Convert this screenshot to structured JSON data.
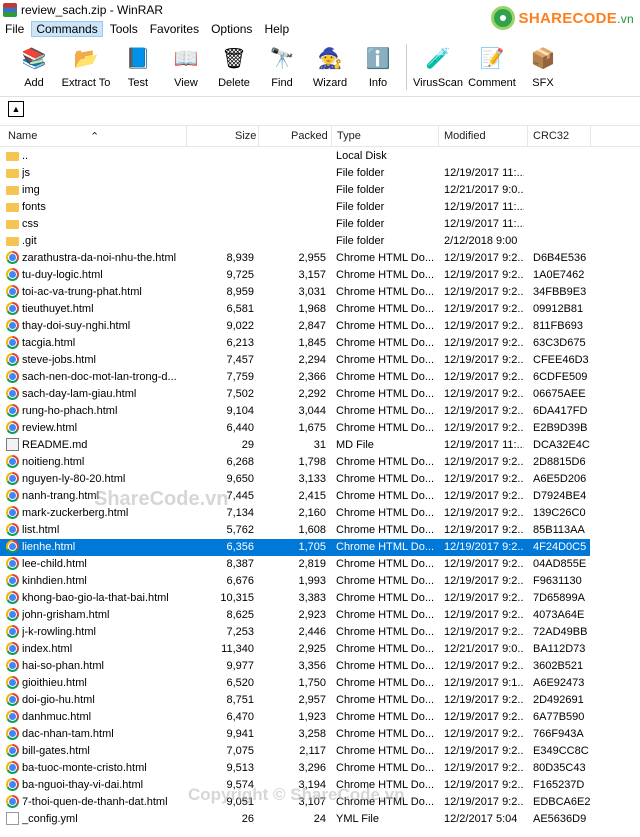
{
  "window": {
    "title": "review_sach.zip - WinRAR"
  },
  "logo": {
    "brand": "SHARECODE",
    "suffix": ".vn"
  },
  "menu": [
    "File",
    "Commands",
    "Tools",
    "Favorites",
    "Options",
    "Help"
  ],
  "toolbar": [
    {
      "label": "Add",
      "icon": "add-icon"
    },
    {
      "label": "Extract To",
      "icon": "extract-icon"
    },
    {
      "label": "Test",
      "icon": "test-icon"
    },
    {
      "label": "View",
      "icon": "view-icon"
    },
    {
      "label": "Delete",
      "icon": "delete-icon"
    },
    {
      "label": "Find",
      "icon": "find-icon"
    },
    {
      "label": "Wizard",
      "icon": "wizard-icon"
    },
    {
      "label": "Info",
      "icon": "info-icon"
    },
    {
      "label": "VirusScan",
      "icon": "virusscan-icon"
    },
    {
      "label": "Comment",
      "icon": "comment-icon"
    },
    {
      "label": "SFX",
      "icon": "sfx-icon"
    }
  ],
  "columns": [
    "Name",
    "Size",
    "Packed",
    "Type",
    "Modified",
    "CRC32"
  ],
  "files": [
    {
      "name": "..",
      "size": "",
      "packed": "",
      "type": "Local Disk",
      "modified": "",
      "crc": "",
      "kind": "folder"
    },
    {
      "name": "js",
      "size": "",
      "packed": "",
      "type": "File folder",
      "modified": "12/19/2017 11:...",
      "crc": "",
      "kind": "folder"
    },
    {
      "name": "img",
      "size": "",
      "packed": "",
      "type": "File folder",
      "modified": "12/21/2017 9:0...",
      "crc": "",
      "kind": "folder"
    },
    {
      "name": "fonts",
      "size": "",
      "packed": "",
      "type": "File folder",
      "modified": "12/19/2017 11:...",
      "crc": "",
      "kind": "folder"
    },
    {
      "name": "css",
      "size": "",
      "packed": "",
      "type": "File folder",
      "modified": "12/19/2017 11:...",
      "crc": "",
      "kind": "folder"
    },
    {
      "name": ".git",
      "size": "",
      "packed": "",
      "type": "File folder",
      "modified": "2/12/2018 9:00",
      "crc": "",
      "kind": "folder"
    },
    {
      "name": "zarathustra-da-noi-nhu-the.html",
      "size": "8,939",
      "packed": "2,955",
      "type": "Chrome HTML Do...",
      "modified": "12/19/2017 9:2...",
      "crc": "D6B4E536",
      "kind": "html"
    },
    {
      "name": "tu-duy-logic.html",
      "size": "9,725",
      "packed": "3,157",
      "type": "Chrome HTML Do...",
      "modified": "12/19/2017 9:2...",
      "crc": "1A0E7462",
      "kind": "html"
    },
    {
      "name": "toi-ac-va-trung-phat.html",
      "size": "8,959",
      "packed": "3,031",
      "type": "Chrome HTML Do...",
      "modified": "12/19/2017 9:2...",
      "crc": "34FBB9E3",
      "kind": "html"
    },
    {
      "name": "tieuthuyet.html",
      "size": "6,581",
      "packed": "1,968",
      "type": "Chrome HTML Do...",
      "modified": "12/19/2017 9:2...",
      "crc": "09912B81",
      "kind": "html"
    },
    {
      "name": "thay-doi-suy-nghi.html",
      "size": "9,022",
      "packed": "2,847",
      "type": "Chrome HTML Do...",
      "modified": "12/19/2017 9:2...",
      "crc": "811FB693",
      "kind": "html"
    },
    {
      "name": "tacgia.html",
      "size": "6,213",
      "packed": "1,845",
      "type": "Chrome HTML Do...",
      "modified": "12/19/2017 9:2...",
      "crc": "63C3D675",
      "kind": "html"
    },
    {
      "name": "steve-jobs.html",
      "size": "7,457",
      "packed": "2,294",
      "type": "Chrome HTML Do...",
      "modified": "12/19/2017 9:2...",
      "crc": "CFEE46D3",
      "kind": "html"
    },
    {
      "name": "sach-nen-doc-mot-lan-trong-d...",
      "size": "7,759",
      "packed": "2,366",
      "type": "Chrome HTML Do...",
      "modified": "12/19/2017 9:2...",
      "crc": "6CDFE509",
      "kind": "html"
    },
    {
      "name": "sach-day-lam-giau.html",
      "size": "7,502",
      "packed": "2,292",
      "type": "Chrome HTML Do...",
      "modified": "12/19/2017 9:2...",
      "crc": "06675AEE",
      "kind": "html"
    },
    {
      "name": "rung-ho-phach.html",
      "size": "9,104",
      "packed": "3,044",
      "type": "Chrome HTML Do...",
      "modified": "12/19/2017 9:2...",
      "crc": "6DA417FD",
      "kind": "html"
    },
    {
      "name": "review.html",
      "size": "6,440",
      "packed": "1,675",
      "type": "Chrome HTML Do...",
      "modified": "12/19/2017 9:2...",
      "crc": "E2B9D39B",
      "kind": "html"
    },
    {
      "name": "README.md",
      "size": "29",
      "packed": "31",
      "type": "MD File",
      "modified": "12/19/2017 11:...",
      "crc": "DCA32E4C",
      "kind": "md"
    },
    {
      "name": "noitieng.html",
      "size": "6,268",
      "packed": "1,798",
      "type": "Chrome HTML Do...",
      "modified": "12/19/2017 9:2...",
      "crc": "2D8815D6",
      "kind": "html"
    },
    {
      "name": "nguyen-ly-80-20.html",
      "size": "9,650",
      "packed": "3,133",
      "type": "Chrome HTML Do...",
      "modified": "12/19/2017 9:2...",
      "crc": "A6E5D206",
      "kind": "html"
    },
    {
      "name": "nanh-trang.html",
      "size": "7,445",
      "packed": "2,415",
      "type": "Chrome HTML Do...",
      "modified": "12/19/2017 9:2...",
      "crc": "D7924BE4",
      "kind": "html"
    },
    {
      "name": "mark-zuckerberg.html",
      "size": "7,134",
      "packed": "2,160",
      "type": "Chrome HTML Do...",
      "modified": "12/19/2017 9:2...",
      "crc": "139C26C0",
      "kind": "html"
    },
    {
      "name": "list.html",
      "size": "5,762",
      "packed": "1,608",
      "type": "Chrome HTML Do...",
      "modified": "12/19/2017 9:2...",
      "crc": "85B113AA",
      "kind": "html"
    },
    {
      "name": "lienhe.html",
      "size": "6,356",
      "packed": "1,705",
      "type": "Chrome HTML Do...",
      "modified": "12/19/2017 9:2...",
      "crc": "4F24D0C5",
      "kind": "html",
      "selected": true
    },
    {
      "name": "lee-child.html",
      "size": "8,387",
      "packed": "2,819",
      "type": "Chrome HTML Do...",
      "modified": "12/19/2017 9:2...",
      "crc": "04AD855E",
      "kind": "html"
    },
    {
      "name": "kinhdien.html",
      "size": "6,676",
      "packed": "1,993",
      "type": "Chrome HTML Do...",
      "modified": "12/19/2017 9:2...",
      "crc": "F9631130",
      "kind": "html"
    },
    {
      "name": "khong-bao-gio-la-that-bai.html",
      "size": "10,315",
      "packed": "3,383",
      "type": "Chrome HTML Do...",
      "modified": "12/19/2017 9:2...",
      "crc": "7D65899A",
      "kind": "html"
    },
    {
      "name": "john-grisham.html",
      "size": "8,625",
      "packed": "2,923",
      "type": "Chrome HTML Do...",
      "modified": "12/19/2017 9:2...",
      "crc": "4073A64E",
      "kind": "html"
    },
    {
      "name": "j-k-rowling.html",
      "size": "7,253",
      "packed": "2,446",
      "type": "Chrome HTML Do...",
      "modified": "12/19/2017 9:2...",
      "crc": "72AD49BB",
      "kind": "html"
    },
    {
      "name": "index.html",
      "size": "11,340",
      "packed": "2,925",
      "type": "Chrome HTML Do...",
      "modified": "12/21/2017 9:0...",
      "crc": "BA112D73",
      "kind": "html"
    },
    {
      "name": "hai-so-phan.html",
      "size": "9,977",
      "packed": "3,356",
      "type": "Chrome HTML Do...",
      "modified": "12/19/2017 9:2...",
      "crc": "3602B521",
      "kind": "html"
    },
    {
      "name": "gioithieu.html",
      "size": "6,520",
      "packed": "1,750",
      "type": "Chrome HTML Do...",
      "modified": "12/19/2017 9:1...",
      "crc": "A6E92473",
      "kind": "html"
    },
    {
      "name": "doi-gio-hu.html",
      "size": "8,751",
      "packed": "2,957",
      "type": "Chrome HTML Do...",
      "modified": "12/19/2017 9:2...",
      "crc": "2D492691",
      "kind": "html"
    },
    {
      "name": "danhmuc.html",
      "size": "6,470",
      "packed": "1,923",
      "type": "Chrome HTML Do...",
      "modified": "12/19/2017 9:2...",
      "crc": "6A77B590",
      "kind": "html"
    },
    {
      "name": "dac-nhan-tam.html",
      "size": "9,941",
      "packed": "3,258",
      "type": "Chrome HTML Do...",
      "modified": "12/19/2017 9:2...",
      "crc": "766F943A",
      "kind": "html"
    },
    {
      "name": "bill-gates.html",
      "size": "7,075",
      "packed": "2,117",
      "type": "Chrome HTML Do...",
      "modified": "12/19/2017 9:2...",
      "crc": "E349CC8C",
      "kind": "html"
    },
    {
      "name": "ba-tuoc-monte-cristo.html",
      "size": "9,513",
      "packed": "3,296",
      "type": "Chrome HTML Do...",
      "modified": "12/19/2017 9:2...",
      "crc": "80D35C43",
      "kind": "html"
    },
    {
      "name": "ba-nguoi-thay-vi-dai.html",
      "size": "9,574",
      "packed": "3,194",
      "type": "Chrome HTML Do...",
      "modified": "12/19/2017 9:2...",
      "crc": "F165237D",
      "kind": "html"
    },
    {
      "name": "7-thoi-quen-de-thanh-dat.html",
      "size": "9,051",
      "packed": "3,107",
      "type": "Chrome HTML Do...",
      "modified": "12/19/2017 9:2...",
      "crc": "EDBCA6E2",
      "kind": "html"
    },
    {
      "name": "_config.yml",
      "size": "26",
      "packed": "24",
      "type": "YML File",
      "modified": "12/2/2017 5:04",
      "crc": "AE5636D9",
      "kind": "yml"
    }
  ],
  "watermarks": [
    "ShareCode.vn",
    "Copyright © ShareCode.vn"
  ]
}
